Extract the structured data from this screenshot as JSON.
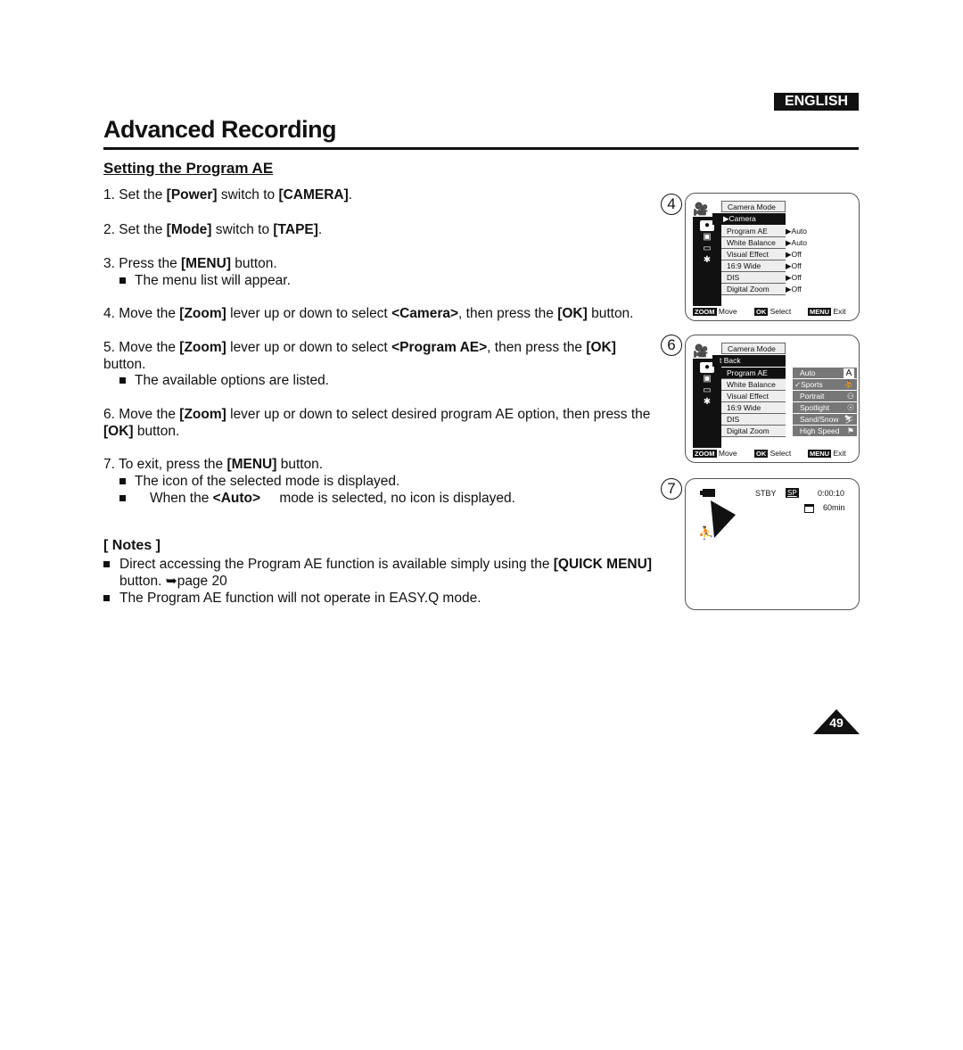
{
  "header": {
    "language_badge": "ENGLISH",
    "title": "Advanced Recording",
    "subtitle": "Setting the Program AE"
  },
  "steps": [
    {
      "num": "1.",
      "parts": [
        [
          "t",
          "Set the "
        ],
        [
          "b",
          "[Power]"
        ],
        [
          "t",
          " switch to "
        ],
        [
          "b",
          "[CAMERA]"
        ],
        [
          "t",
          "."
        ]
      ]
    },
    {
      "num": "2.",
      "parts": [
        [
          "t",
          "Set the "
        ],
        [
          "b",
          "[Mode]"
        ],
        [
          "t",
          " switch to "
        ],
        [
          "b",
          "[TAPE]"
        ],
        [
          "t",
          "."
        ]
      ]
    },
    {
      "num": "3.",
      "parts": [
        [
          "t",
          "Press the "
        ],
        [
          "b",
          "[MENU]"
        ],
        [
          "t",
          " button."
        ]
      ],
      "bullets": [
        "The menu list will appear."
      ]
    },
    {
      "num": "4.",
      "parts": [
        [
          "t",
          "Move the "
        ],
        [
          "b",
          "[Zoom]"
        ],
        [
          "t",
          " lever up or down to select "
        ],
        [
          "b",
          "<Camera>"
        ],
        [
          "t",
          ", then press the "
        ],
        [
          "b",
          "[OK]"
        ],
        [
          "t",
          " button."
        ]
      ]
    },
    {
      "num": "5.",
      "parts": [
        [
          "t",
          "Move the "
        ],
        [
          "b",
          "[Zoom]"
        ],
        [
          "t",
          " lever up or down to select "
        ],
        [
          "b",
          "<Program AE>"
        ],
        [
          "t",
          ", then press the "
        ],
        [
          "b",
          "[OK]"
        ],
        [
          "t",
          " button."
        ]
      ],
      "bullets": [
        "The available options are listed."
      ]
    },
    {
      "num": "6.",
      "parts": [
        [
          "t",
          "Move the "
        ],
        [
          "b",
          "[Zoom]"
        ],
        [
          "t",
          " lever up or down to select desired program AE option, then press the "
        ],
        [
          "b",
          "[OK]"
        ],
        [
          "t",
          " button."
        ]
      ]
    },
    {
      "num": "7.",
      "parts": [
        [
          "t",
          "To exit, press the "
        ],
        [
          "b",
          "[MENU]"
        ],
        [
          "t",
          " button."
        ]
      ],
      "bullets": [
        "The icon of the selected mode is displayed.",
        [
          [
            "t",
            "When the "
          ],
          [
            "b",
            "<Auto>"
          ],
          [
            "t",
            " mode is selected, no icon is displayed."
          ]
        ]
      ]
    }
  ],
  "notes": {
    "heading": "[ Notes ]",
    "items": [
      [
        [
          "t",
          "Direct accessing the Program AE function is available simply using the "
        ],
        [
          "b",
          "[QUICK MENU]"
        ],
        [
          "t",
          " button. ➥page 20"
        ]
      ],
      [
        [
          "t",
          "The Program AE function will not operate in EASY.Q mode."
        ]
      ]
    ]
  },
  "figures": {
    "fig4": {
      "number": "4",
      "menu_header": "Camera Mode",
      "submenu": "▶Camera",
      "items": [
        "Program AE",
        "White Balance",
        "Visual Effect",
        "16:9 Wide",
        "DIS",
        "Digital Zoom"
      ],
      "values": [
        "▶Auto",
        "▶Auto",
        "▶Off",
        "▶Off",
        "▶Off",
        "▶Off"
      ],
      "footer": {
        "zoom_key": "ZOOM",
        "zoom_label": "Move",
        "ok_key": "OK",
        "ok_label": "Select",
        "menu_key": "MENU",
        "menu_label": "Exit"
      }
    },
    "fig6": {
      "number": "6",
      "menu_header": "Camera Mode",
      "submenu": "t Back",
      "items": [
        "Program AE",
        "White Balance",
        "Visual Effect",
        "16:9 Wide",
        "DIS",
        "Digital Zoom"
      ],
      "options": [
        {
          "label": "Auto",
          "icon": "A",
          "icon_name": "auto-icon"
        },
        {
          "label": "✓Sports",
          "icon": "⛹",
          "icon_name": "sports-icon"
        },
        {
          "label": "Portrait",
          "icon": "⚇",
          "icon_name": "portrait-icon"
        },
        {
          "label": "Spotlight",
          "icon": "☉",
          "icon_name": "spotlight-icon"
        },
        {
          "label": "Sand/Snow",
          "icon": "⛷",
          "icon_name": "sand-snow-icon"
        },
        {
          "label": "High Speed",
          "icon": "⚑",
          "icon_name": "high-speed-icon"
        }
      ],
      "selected_option": "Sports",
      "footer": {
        "zoom_key": "ZOOM",
        "zoom_label": "Move",
        "ok_key": "OK",
        "ok_label": "Select",
        "menu_key": "MENU",
        "menu_label": "Exit"
      }
    },
    "fig7": {
      "number": "7",
      "status": "STBY",
      "speed": "SP",
      "timecode": "0:00:10",
      "tape_remaining": "60min"
    }
  },
  "page_number": "49"
}
